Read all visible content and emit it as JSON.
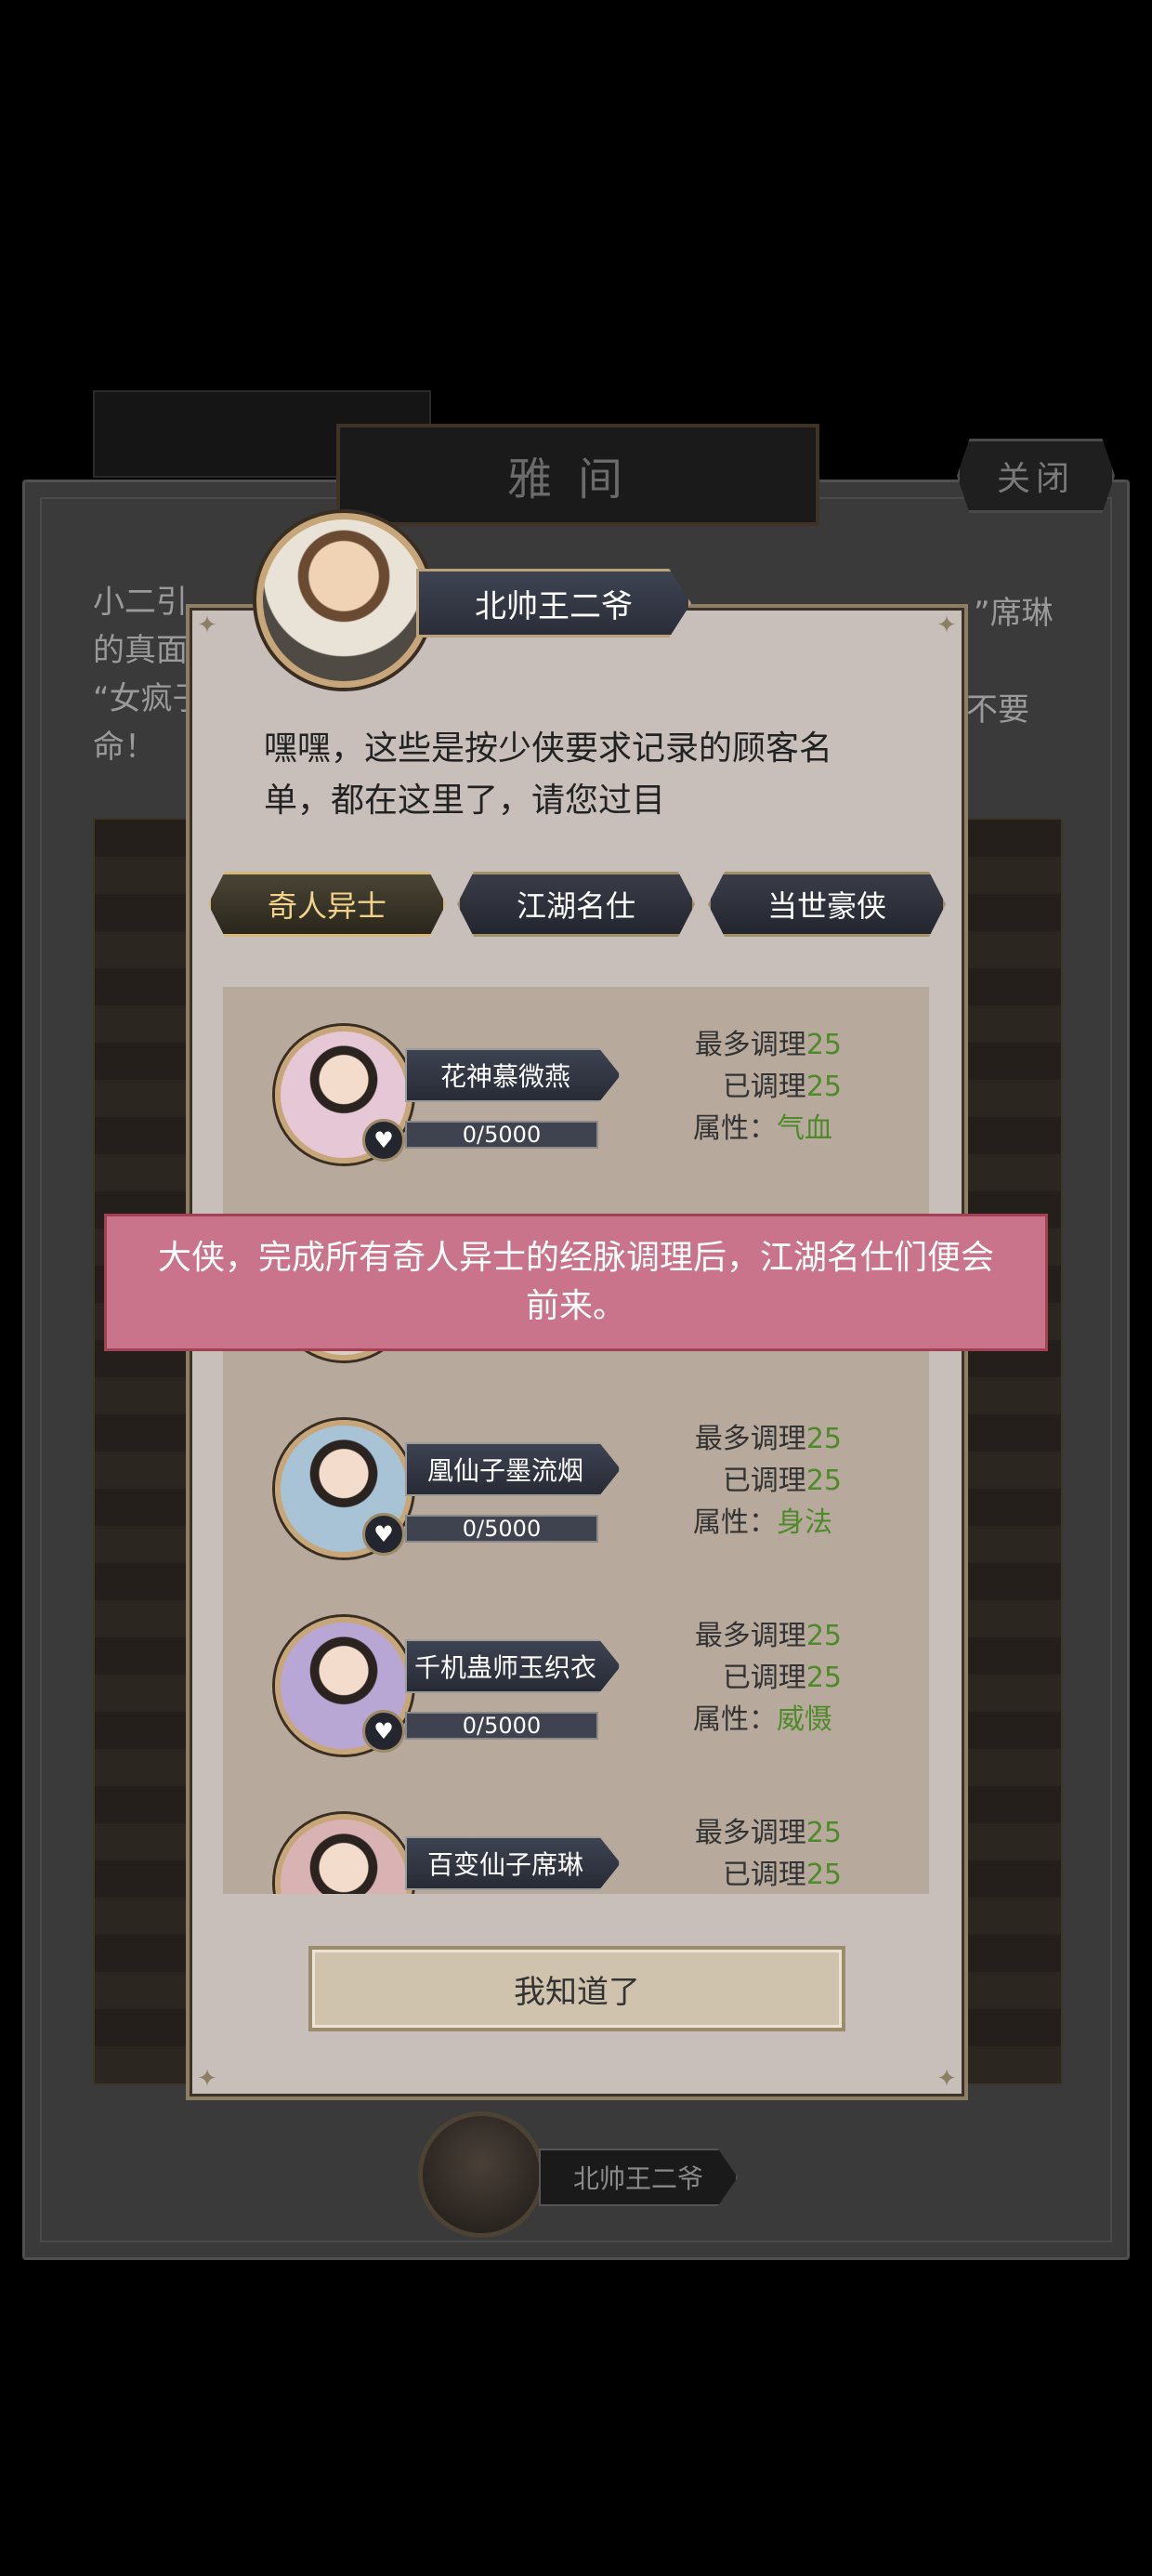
{
  "background": {
    "title": "雅间",
    "close_label": "关闭",
    "story_lines": [
      "小二引",
      "的真面",
      "“女疯子",
      "命！"
    ],
    "story_right_1": "”席琳",
    "story_right_2": "不要",
    "bottom_speaker": "北帅王二爷"
  },
  "dialog": {
    "speaker": "北帅王二爷",
    "speech": "嘿嘿，这些是按少侠要求记录的顾客名单，都在这里了，请您过目",
    "tabs": [
      {
        "label": "奇人异士",
        "active": true
      },
      {
        "label": "江湖名仕",
        "active": false
      },
      {
        "label": "当世豪侠",
        "active": false
      }
    ],
    "stat_labels": {
      "max": "最多调理",
      "done": "已调理",
      "attr": "属性："
    },
    "characters": [
      {
        "name": "花神慕微燕",
        "progress_text": "0/5000",
        "progress": 0,
        "max": "25",
        "done": "25",
        "attr": "气血",
        "avatar_color": "#e6c7d6"
      },
      {
        "name": "",
        "progress_text": "",
        "progress": 0,
        "max": "",
        "done": "",
        "attr": "",
        "avatar_color": "#d9cfc4"
      },
      {
        "name": "凰仙子墨流烟",
        "progress_text": "0/5000",
        "progress": 0,
        "max": "25",
        "done": "25",
        "attr": "身法",
        "avatar_color": "#a9c3d6"
      },
      {
        "name": "千机蛊师玉织衣",
        "progress_text": "0/5000",
        "progress": 0,
        "max": "25",
        "done": "25",
        "attr": "威慑",
        "avatar_color": "#b8a7d4"
      },
      {
        "name": "百变仙子席琳",
        "progress_text": "",
        "progress": 0,
        "max": "25",
        "done": "25",
        "attr": "",
        "avatar_color": "#d9b3b3"
      }
    ],
    "notice": "大侠，完成所有奇人异士的经脉调理后，江湖名仕们便会前来。",
    "confirm_label": "我知道了"
  }
}
